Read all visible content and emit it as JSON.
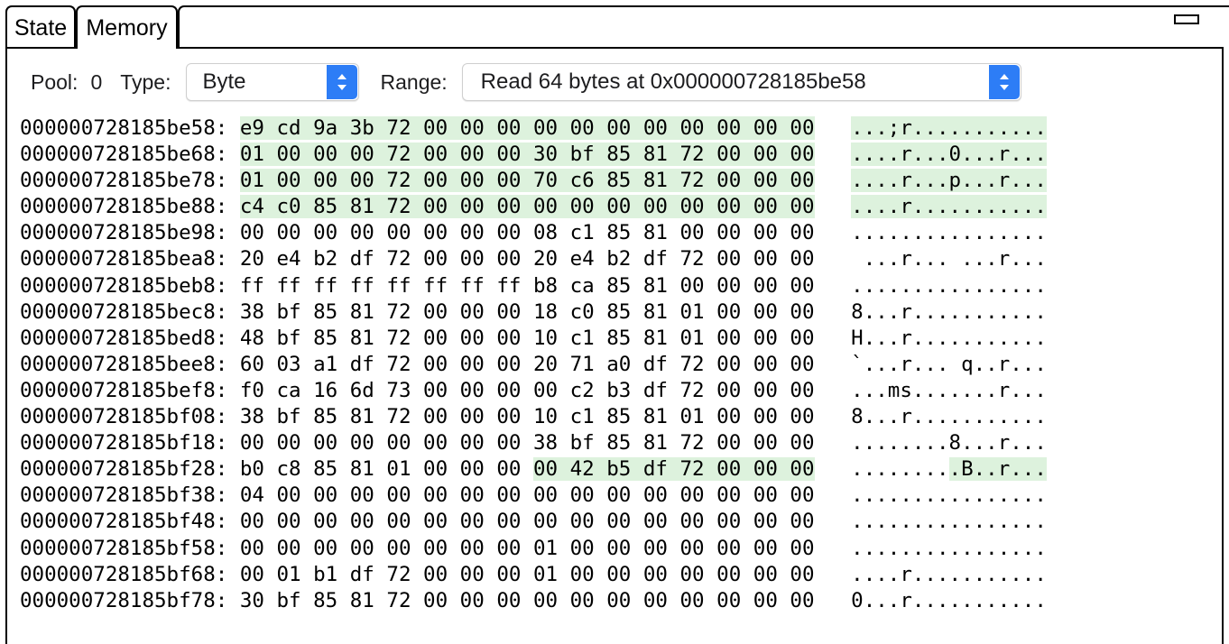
{
  "window": {
    "minimize_icon": "minimize-icon"
  },
  "tabs": [
    {
      "id": "state",
      "label": "State",
      "active": false
    },
    {
      "id": "memory",
      "label": "Memory",
      "active": true
    }
  ],
  "toolbar": {
    "pool_label": "Pool:",
    "pool_value": "0",
    "type_label": "Type:",
    "type_value": "Byte",
    "type_options": [
      "Byte"
    ],
    "range_label": "Range:",
    "range_value": "Read 64 bytes at 0x000000728185be58",
    "range_options": [
      "Read 64 bytes at 0x000000728185be58"
    ],
    "chevron_icon": "chevron-up-down-icon"
  },
  "colors": {
    "highlight": "#ddf2dd",
    "popup_accent": "#2d7df6",
    "text": "#000000"
  },
  "memory": {
    "bytes_per_row": 16,
    "rows": [
      {
        "address": "000000728185be58",
        "hex": "e9 cd 9a 3b 72 00 00 00 00 00 00 00 00 00 00 00",
        "ascii": "...;r...........",
        "hex_highlight": [
          0,
          16
        ],
        "ascii_highlight": [
          0,
          16
        ]
      },
      {
        "address": "000000728185be68",
        "hex": "01 00 00 00 72 00 00 00 30 bf 85 81 72 00 00 00",
        "ascii": "....r...0...r...",
        "hex_highlight": [
          0,
          16
        ],
        "ascii_highlight": [
          0,
          16
        ]
      },
      {
        "address": "000000728185be78",
        "hex": "01 00 00 00 72 00 00 00 70 c6 85 81 72 00 00 00",
        "ascii": "....r...p...r...",
        "hex_highlight": [
          0,
          16
        ],
        "ascii_highlight": [
          0,
          16
        ]
      },
      {
        "address": "000000728185be88",
        "hex": "c4 c0 85 81 72 00 00 00 00 00 00 00 00 00 00 00",
        "ascii": "....r...........",
        "hex_highlight": [
          0,
          16
        ],
        "ascii_highlight": [
          0,
          16
        ]
      },
      {
        "address": "000000728185be98",
        "hex": "00 00 00 00 00 00 00 00 08 c1 85 81 00 00 00 00",
        "ascii": "................",
        "hex_highlight": null,
        "ascii_highlight": null
      },
      {
        "address": "000000728185bea8",
        "hex": "20 e4 b2 df 72 00 00 00 20 e4 b2 df 72 00 00 00",
        "ascii": " ...r... ...r...",
        "hex_highlight": null,
        "ascii_highlight": null
      },
      {
        "address": "000000728185beb8",
        "hex": "ff ff ff ff ff ff ff ff b8 ca 85 81 00 00 00 00",
        "ascii": "................",
        "hex_highlight": null,
        "ascii_highlight": null
      },
      {
        "address": "000000728185bec8",
        "hex": "38 bf 85 81 72 00 00 00 18 c0 85 81 01 00 00 00",
        "ascii": "8...r...........",
        "hex_highlight": null,
        "ascii_highlight": null
      },
      {
        "address": "000000728185bed8",
        "hex": "48 bf 85 81 72 00 00 00 10 c1 85 81 01 00 00 00",
        "ascii": "H...r...........",
        "hex_highlight": null,
        "ascii_highlight": null
      },
      {
        "address": "000000728185bee8",
        "hex": "60 03 a1 df 72 00 00 00 20 71 a0 df 72 00 00 00",
        "ascii": "`...r... q..r...",
        "hex_highlight": null,
        "ascii_highlight": null
      },
      {
        "address": "000000728185bef8",
        "hex": "f0 ca 16 6d 73 00 00 00 00 c2 b3 df 72 00 00 00",
        "ascii": "...ms.......r...",
        "hex_highlight": null,
        "ascii_highlight": null
      },
      {
        "address": "000000728185bf08",
        "hex": "38 bf 85 81 72 00 00 00 10 c1 85 81 01 00 00 00",
        "ascii": "8...r...........",
        "hex_highlight": null,
        "ascii_highlight": null
      },
      {
        "address": "000000728185bf18",
        "hex": "00 00 00 00 00 00 00 00 38 bf 85 81 72 00 00 00",
        "ascii": "........8...r...",
        "hex_highlight": null,
        "ascii_highlight": null
      },
      {
        "address": "000000728185bf28",
        "hex": "b0 c8 85 81 01 00 00 00 00 42 b5 df 72 00 00 00",
        "ascii": ".........B..r...",
        "hex_highlight": [
          8,
          16
        ],
        "ascii_highlight": [
          8,
          16
        ]
      },
      {
        "address": "000000728185bf38",
        "hex": "04 00 00 00 00 00 00 00 00 00 00 00 00 00 00 00",
        "ascii": "................",
        "hex_highlight": null,
        "ascii_highlight": null
      },
      {
        "address": "000000728185bf48",
        "hex": "00 00 00 00 00 00 00 00 00 00 00 00 00 00 00 00",
        "ascii": "................",
        "hex_highlight": null,
        "ascii_highlight": null
      },
      {
        "address": "000000728185bf58",
        "hex": "00 00 00 00 00 00 00 00 01 00 00 00 00 00 00 00",
        "ascii": "................",
        "hex_highlight": null,
        "ascii_highlight": null
      },
      {
        "address": "000000728185bf68",
        "hex": "00 01 b1 df 72 00 00 00 01 00 00 00 00 00 00 00",
        "ascii": "....r...........",
        "hex_highlight": null,
        "ascii_highlight": null
      },
      {
        "address": "000000728185bf78",
        "hex": "30 bf 85 81 72 00 00 00 00 00 00 00 00 00 00 00",
        "ascii": "0...r...........",
        "hex_highlight": null,
        "ascii_highlight": null
      }
    ]
  }
}
